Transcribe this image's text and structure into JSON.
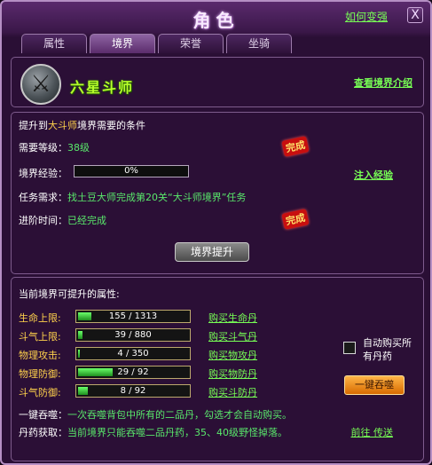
{
  "window": {
    "title": "角色",
    "howto_link": "如何变强",
    "close": "X"
  },
  "tabs": [
    {
      "label": "属性",
      "active": false
    },
    {
      "label": "境界",
      "active": true
    },
    {
      "label": "荣誉",
      "active": false
    },
    {
      "label": "坐骑",
      "active": false
    }
  ],
  "realm": {
    "name": "六星斗师",
    "view_intro_link": "查看境界介绍"
  },
  "conditions": {
    "header_prefix": "提升到",
    "header_target": "大斗师",
    "header_suffix": "境界需要的条件",
    "level_label": "需要等级：",
    "level_value": "38级",
    "level_status": "完成",
    "exp_label": "境界经验：",
    "exp_value": "0%",
    "exp_progress": 0,
    "inject_link": "注入经验",
    "task_label": "任务需求：",
    "task_value": "找土豆大师完成第20关“大斗师境界”任务",
    "time_label": "进阶时间：",
    "time_value": "已经完成",
    "time_status": "完成",
    "upgrade_button": "境界提升",
    "status_color": "#c80f0f"
  },
  "attributes": {
    "title": "当前境界可提升的属性:",
    "rows": [
      {
        "label": "生命上限:",
        "value": "155 / 1313",
        "fraction": 0.118,
        "buy": "购买生命丹"
      },
      {
        "label": "斗气上限:",
        "value": "39 / 880",
        "fraction": 0.044,
        "buy": "购买斗气丹"
      },
      {
        "label": "物理攻击:",
        "value": "4 / 350",
        "fraction": 0.011,
        "buy": "购买物攻丹"
      },
      {
        "label": "物理防御:",
        "value": "29 / 92",
        "fraction": 0.315,
        "buy": "购买物防丹"
      },
      {
        "label": "斗气防御:",
        "value": "8 / 92",
        "fraction": 0.087,
        "buy": "购买斗防丹"
      }
    ],
    "auto_buy_label": "自动购买所有丹药",
    "auto_buy_checked": false,
    "swallow_button": "一键吞噬",
    "desc1_label": "一键吞噬：",
    "desc1_text": "一次吞噬背包中所有的二品丹，勾选才会自动购买。",
    "desc2_label": "丹药获取：",
    "desc2_text": "当前境界只能吞噬二品丹药，35、40级野怪掉落。",
    "goto_link": "前往 传送"
  },
  "colors": {
    "accent_green": "#77ff55",
    "accent_yellow": "#ffd24c",
    "bar_green": "#3fd43f"
  }
}
